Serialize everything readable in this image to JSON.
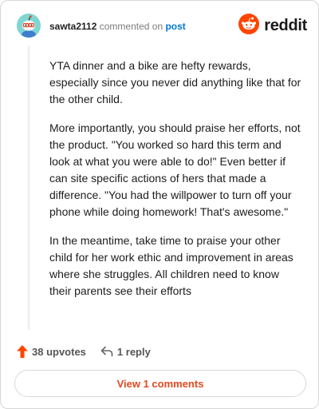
{
  "comment": {
    "username": "sawta2112",
    "action_text": "commented on",
    "post_link": "post",
    "brand": "reddit",
    "paragraphs": [
      "YTA dinner and a bike are hefty rewards, especially since you never did anything like that for the other child.",
      "More importantly, you should praise her efforts, not the product. \"You worked so hard this term and look at what you were able to do!\" Even better if can site specific actions of hers that made a difference. \"You had the willpower to turn off your phone while doing homework! That's awesome.\"",
      "In the meantime, take time to praise your other child for her work ethic and improvement in areas where she struggles. All children need to know their parents see their efforts"
    ],
    "upvotes_label": "38 upvotes",
    "reply_label": "1 reply",
    "view_comments_label": "View 1 comments"
  },
  "icons": {
    "upvote": "upvote-arrow-icon",
    "reply": "reply-arrow-icon",
    "brand": "reddit-logo-icon",
    "avatar": "snoo-avatar-icon"
  },
  "colors": {
    "upvote": "#ff4500",
    "brand": "#ff4500",
    "post_link": "#0079d3",
    "view_button_text": "#e5481f"
  }
}
